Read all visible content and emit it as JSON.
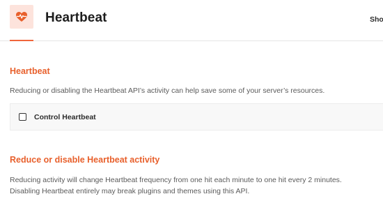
{
  "header": {
    "title": "Heartbeat",
    "icon": "heart-pulse-icon",
    "sidebar_toggle_label": "Sho"
  },
  "sections": [
    {
      "title": "Heartbeat",
      "description": "Reducing or disabling the Heartbeat API’s activity can help save some of your server’s resources."
    },
    {
      "title": "Reduce or disable Heartbeat activity",
      "description_lines": [
        "Reducing activity will change Heartbeat frequency from one hit each minute to one hit every 2 minutes.",
        "Disabling Heartbeat entirely may break plugins and themes using this API."
      ]
    }
  ],
  "options": {
    "control_heartbeat": {
      "label": "Control Heartbeat",
      "checked": false
    }
  },
  "colors": {
    "accent": "#e8602c",
    "icon_bg": "#fde3dc",
    "card_bg": "#f8f8f8"
  }
}
